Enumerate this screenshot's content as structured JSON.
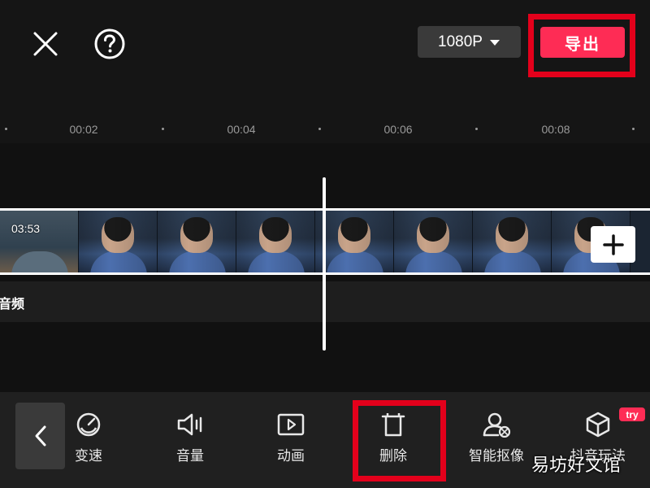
{
  "header": {
    "resolution": {
      "label": "1080P",
      "icon": "caret-down-icon"
    },
    "export_label": "导出",
    "close_icon": "close-icon",
    "help_icon": "help-circle-icon"
  },
  "ruler": {
    "ticks": [
      "00:02",
      "00:04",
      "00:06",
      "00:08"
    ]
  },
  "timeline": {
    "clip_duration": "03:53",
    "add_icon": "plus-icon",
    "audio_label": "音频"
  },
  "toolbar": {
    "back_icon": "chevron-left-icon",
    "items": [
      {
        "label": "变速",
        "icon": "speed-gauge-icon"
      },
      {
        "label": "音量",
        "icon": "volume-icon"
      },
      {
        "label": "动画",
        "icon": "play-square-icon"
      },
      {
        "label": "删除",
        "icon": "trash-icon"
      },
      {
        "label": "智能抠像",
        "icon": "person-cutout-icon"
      },
      {
        "label": "抖音玩法",
        "icon": "cube-icon"
      }
    ],
    "badge": "try"
  },
  "watermark": "易坊好文馆",
  "colors": {
    "accent": "#fe2c55",
    "highlight_box": "#e3001b",
    "background": "#111111",
    "toolbar": "#202020"
  }
}
